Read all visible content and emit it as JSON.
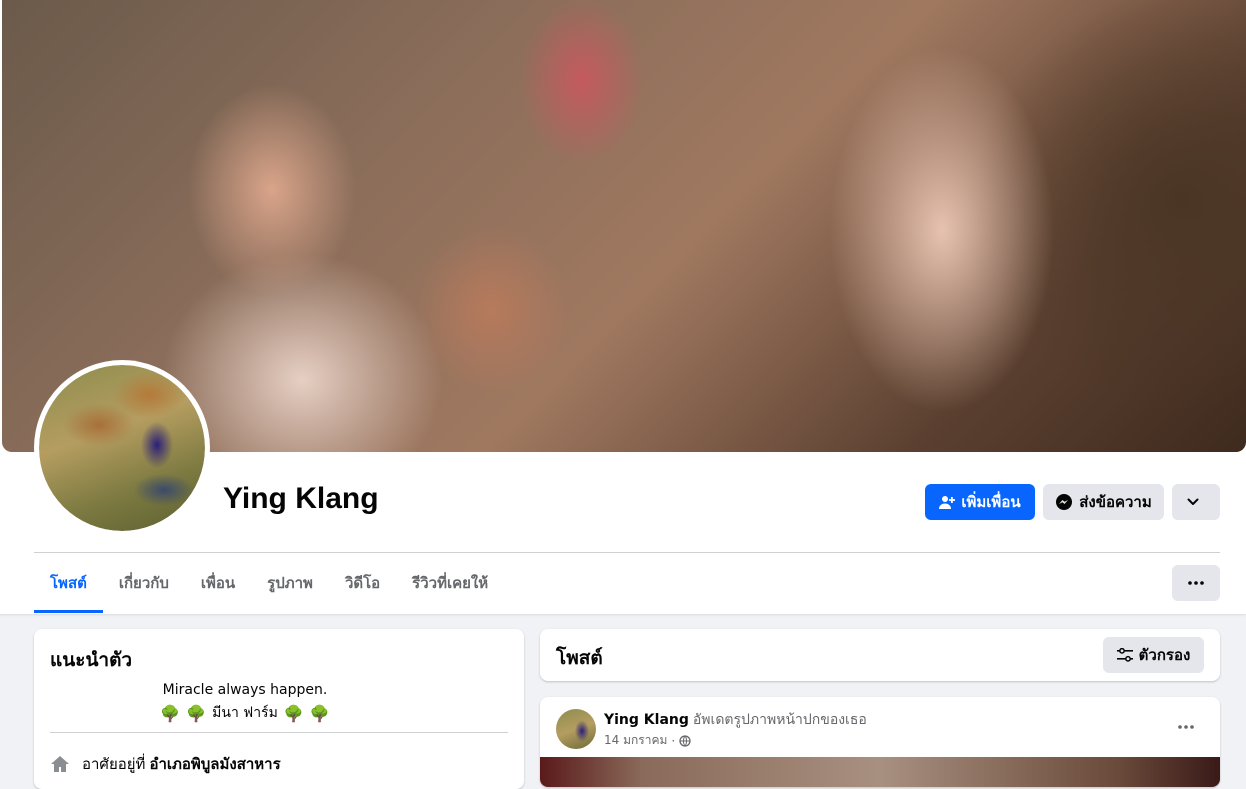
{
  "profile": {
    "name": "Ying Klang"
  },
  "actions": {
    "add_friend": "เพิ่มเพื่อน",
    "message": "ส่งข้อความ"
  },
  "tabs": [
    {
      "label": "โพสต์",
      "active": true
    },
    {
      "label": "เกี่ยวกับ",
      "active": false
    },
    {
      "label": "เพื่อน",
      "active": false
    },
    {
      "label": "รูปภาพ",
      "active": false
    },
    {
      "label": "วิดีโอ",
      "active": false
    },
    {
      "label": "รีวิวที่เคยให้",
      "active": false
    }
  ],
  "intro": {
    "title": "แนะนำตัว",
    "bio_line1": "Miracle always happen.",
    "bio_line2": "มีนา ฟาร์ม",
    "home_label": "อาศัยอยู่ที่",
    "home_value": "อำเภอพิบูลมังสาหาร"
  },
  "posts_header": {
    "title": "โพสต์",
    "filter_label": "ตัวกรอง"
  },
  "post": {
    "author": "Ying Klang",
    "action": "อัพเดตรูปภาพหน้าปกของเธอ",
    "date": "14 มกราคม",
    "separator": "·"
  },
  "colors": {
    "accent": "#0866ff",
    "secondary_button": "#e4e6eb",
    "background": "#f0f2f5"
  }
}
